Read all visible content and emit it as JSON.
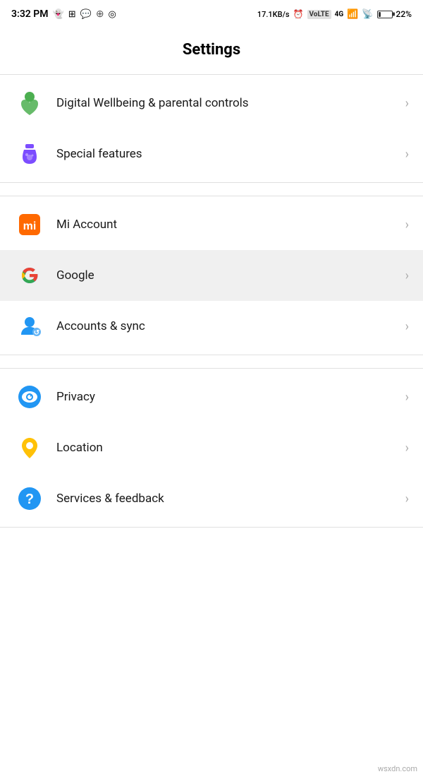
{
  "statusBar": {
    "time": "3:32 PM",
    "networkSpeed": "17.1KB/s",
    "batteryPercent": "22%"
  },
  "page": {
    "title": "Settings"
  },
  "sections": [
    {
      "id": "section1",
      "items": [
        {
          "id": "digital-wellbeing",
          "label": "Digital Wellbeing & parental controls",
          "icon": "wellbeing",
          "highlighted": false
        },
        {
          "id": "special-features",
          "label": "Special features",
          "icon": "special",
          "highlighted": false
        }
      ]
    },
    {
      "id": "section2",
      "items": [
        {
          "id": "mi-account",
          "label": "Mi Account",
          "icon": "mi",
          "highlighted": false
        },
        {
          "id": "google",
          "label": "Google",
          "icon": "google",
          "highlighted": true
        },
        {
          "id": "accounts-sync",
          "label": "Accounts & sync",
          "icon": "accounts",
          "highlighted": false
        }
      ]
    },
    {
      "id": "section3",
      "items": [
        {
          "id": "privacy",
          "label": "Privacy",
          "icon": "privacy",
          "highlighted": false
        },
        {
          "id": "location",
          "label": "Location",
          "icon": "location",
          "highlighted": false
        },
        {
          "id": "services-feedback",
          "label": "Services & feedback",
          "icon": "services",
          "highlighted": false
        }
      ]
    }
  ],
  "chevron": "›",
  "watermark": "wsxdn.com"
}
